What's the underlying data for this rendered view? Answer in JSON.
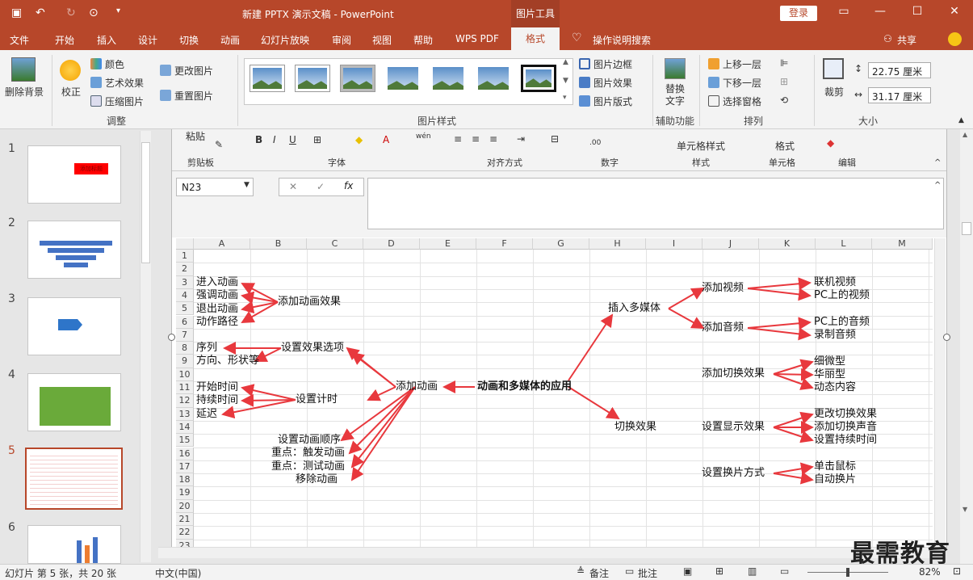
{
  "window": {
    "title": "新建 PPTX 演示文稿 - PowerPoint",
    "context_tab": "图片工具",
    "login": "登录"
  },
  "tabs": [
    "文件",
    "开始",
    "插入",
    "设计",
    "切换",
    "动画",
    "幻灯片放映",
    "审阅",
    "视图",
    "帮助",
    "WPS PDF",
    "格式"
  ],
  "tell_me": "操作说明搜索",
  "share": "共享",
  "ribbon": {
    "remove_bg": "删除背景",
    "correct": "校正",
    "color": "颜色",
    "art_effect": "艺术效果",
    "compress": "压缩图片",
    "change_pic": "更改图片",
    "reset_pic": "重置图片",
    "group_adjust": "调整",
    "border": "图片边框",
    "effect": "图片效果",
    "layout": "图片版式",
    "group_styles": "图片样式",
    "alt_text": "替换文字",
    "group_access": "辅助功能",
    "bring_forward": "上移一层",
    "send_backward": "下移一层",
    "selection_pane": "选择窗格",
    "group_arrange": "排列",
    "crop": "裁剪",
    "height": "22.75 厘米",
    "width": "31.17 厘米",
    "group_size": "大小"
  },
  "excel": {
    "paste": "粘贴",
    "clipboard": "剪贴板",
    "font": "字体",
    "align": "对齐方式",
    "number": "数字",
    "cell_style": "单元格样式",
    "styles": "样式",
    "format": "格式",
    "cells": "单元格",
    "edit": "编辑",
    "namebox": "N23",
    "columns": [
      "A",
      "B",
      "C",
      "D",
      "E",
      "F",
      "G",
      "H",
      "I",
      "J",
      "K",
      "L",
      "M"
    ],
    "rows": [
      "1",
      "2",
      "3",
      "4",
      "5",
      "6",
      "7",
      "8",
      "9",
      "10",
      "11",
      "12",
      "13",
      "14",
      "15",
      "16",
      "17",
      "18",
      "19",
      "20",
      "21",
      "22",
      "23"
    ]
  },
  "mindmap": {
    "center": "动画和多媒体的应用",
    "anim": "添加动画",
    "add_effect": "添加动画效果",
    "effect_opts": "设置效果选项",
    "timing": "设置计时",
    "enter": "进入动画",
    "emphasis": "强调动画",
    "exit": "退出动画",
    "path": "动作路径",
    "sequence": "序列",
    "direction": "方向、形状等",
    "start_time": "开始时间",
    "duration": "持续时间",
    "delay": "延迟",
    "order": "设置动画顺序",
    "trigger": "重点：触发动画",
    "test": "重点：测试动画",
    "remove": "移除动画",
    "insert_media": "插入多媒体",
    "switch": "切换效果",
    "add_video": "添加视频",
    "add_audio": "添加音频",
    "online_video": "联机视频",
    "pc_video": "PC上的视频",
    "pc_audio": "PC上的音频",
    "record_audio": "录制音频",
    "add_switch": "添加切换效果",
    "show_set": "设置显示效果",
    "change_method": "设置换片方式",
    "subtle": "细微型",
    "exciting": "华丽型",
    "dynamic": "动态内容",
    "change_effect": "更改切换效果",
    "add_sound": "添加切换声音",
    "set_duration": "设置持续时间",
    "mouse_click": "单击鼠标",
    "auto_change": "自动换片"
  },
  "slides": [
    "1",
    "2",
    "3",
    "4",
    "5",
    "6"
  ],
  "slide_texts": {
    "s1": "添加标题"
  },
  "status": {
    "slide_info": "幻灯片 第 5 张，共 20 张",
    "lang": "中文(中国)",
    "notes": "备注",
    "comments": "批注",
    "zoom": "82%"
  },
  "watermark": "最需教育",
  "colors": {
    "accent": "#b7472a",
    "arrow": "#e8383d"
  }
}
